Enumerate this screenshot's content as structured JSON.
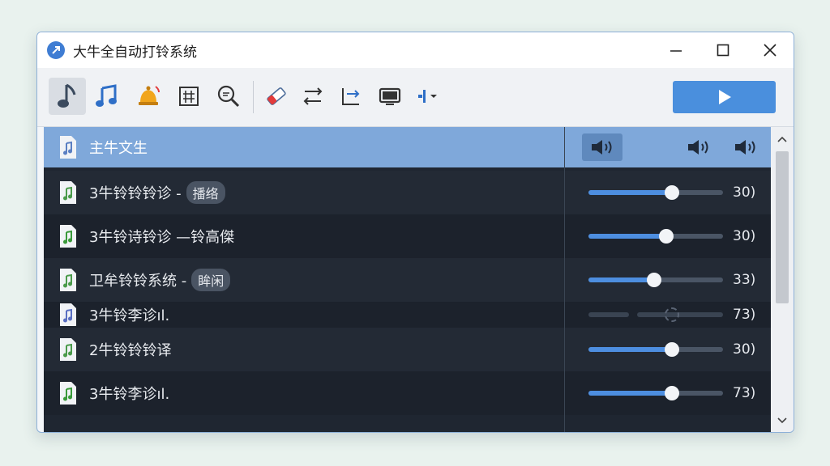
{
  "window": {
    "title": "大牛全自动打铃系统",
    "controls": [
      "minimize",
      "maximize",
      "close"
    ]
  },
  "toolbar": {
    "tools": [
      {
        "name": "music-note-icon",
        "active": true
      },
      {
        "name": "music-notes-icon",
        "active": false
      },
      {
        "name": "bell-icon",
        "active": false
      },
      {
        "name": "schedule-grid-icon",
        "active": false
      },
      {
        "name": "search-icon",
        "active": false
      },
      {
        "name": "eraser-icon",
        "active": false
      },
      {
        "name": "loop-icon",
        "active": false
      },
      {
        "name": "export-icon",
        "active": false
      },
      {
        "name": "monitor-icon",
        "active": false
      },
      {
        "name": "audio-menu-icon",
        "active": false
      }
    ],
    "play_icon": "play-icon"
  },
  "list": {
    "header": {
      "label": "主牛文生"
    },
    "rows": [
      {
        "text": "3牛铃铃铃诊 -",
        "tag": "播络",
        "volume_pct": 62,
        "value": "30)",
        "icon_color": "#4a9a4a"
      },
      {
        "text": "3牛铃诗铃诊 —铃高傑",
        "tag": "",
        "volume_pct": 58,
        "value": "30)",
        "icon_color": "#3a9a3a"
      },
      {
        "text": "卫牟铃铃系统 -",
        "tag": "眸闲",
        "volume_pct": 49,
        "value": "33)",
        "icon_color": "#4a9a4a"
      },
      {
        "text": "3牛铃李诊ıl.",
        "tag": "",
        "volume_pct": 0,
        "value": "73)",
        "icon_color": "#5a6fc2",
        "disabled": true
      },
      {
        "text": "2牛铃铃铃译",
        "tag": "",
        "volume_pct": 62,
        "value": "30)",
        "icon_color": "#4a9a4a"
      },
      {
        "text": "3牛铃李诊ıl.",
        "tag": "",
        "volume_pct": 62,
        "value": "73)",
        "icon_color": "#3a9a3a"
      }
    ]
  },
  "colors": {
    "accent": "#4a8fdd",
    "header_row": "#7fa8da",
    "list_bg": "#1f2631"
  }
}
